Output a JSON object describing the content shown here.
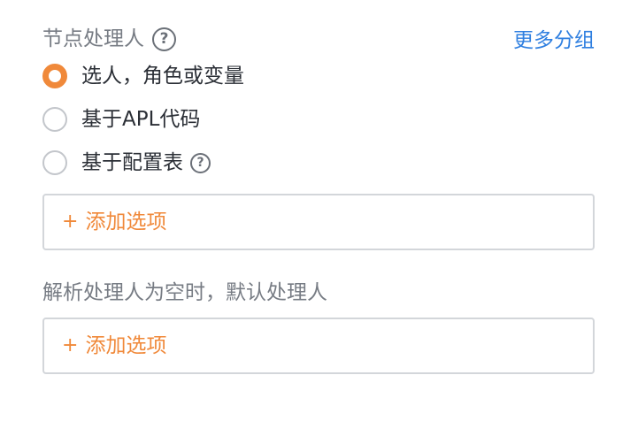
{
  "node_handler": {
    "label": "节点处理人",
    "help_icon": "question-circle-icon",
    "more_link": "更多分组",
    "options": [
      {
        "label": "选人，角色或变量",
        "checked": true
      },
      {
        "label": "基于APL代码",
        "checked": false
      },
      {
        "label": "基于配置表",
        "checked": false,
        "help_icon": "question-circle-icon"
      }
    ],
    "add_option": {
      "icon": "plus-icon",
      "plus": "+",
      "text": "添加选项"
    }
  },
  "fallback_handler": {
    "label": "解析处理人为空时，默认处理人",
    "add_option": {
      "icon": "plus-icon",
      "plus": "+",
      "text": "添加选项"
    }
  },
  "colors": {
    "accent": "#f0893a",
    "link": "#2f7fe0",
    "label": "#777c84",
    "text": "#2b2f36",
    "border": "#d3d6da"
  }
}
